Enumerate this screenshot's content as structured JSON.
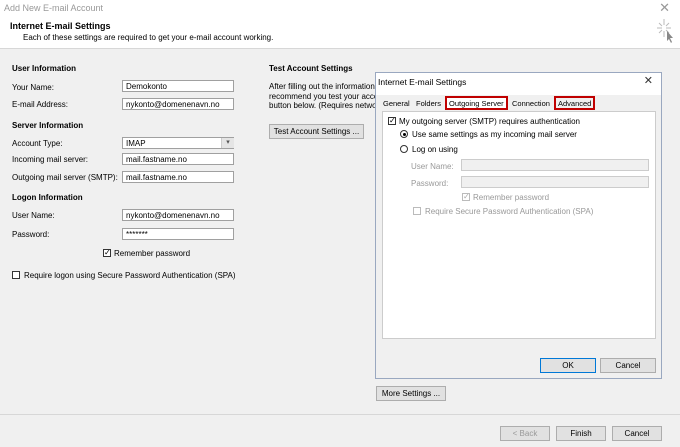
{
  "window": {
    "title": "Add New E-mail Account"
  },
  "header": {
    "title": "Internet E-mail Settings",
    "subtitle": "Each of these settings are required to get your e-mail account working."
  },
  "user_info": {
    "heading": "User Information",
    "your_name_label": "Your Name:",
    "your_name_value": "Demokonto",
    "email_label": "E-mail Address:",
    "email_value": "nykonto@domenenavn.no"
  },
  "server_info": {
    "heading": "Server Information",
    "account_type_label": "Account Type:",
    "account_type_value": "IMAP",
    "incoming_label": "Incoming mail server:",
    "incoming_value": "mail.fastname.no",
    "outgoing_label": "Outgoing mail server (SMTP):",
    "outgoing_value": "mail.fastname.no"
  },
  "logon_info": {
    "heading": "Logon Information",
    "username_label": "User Name:",
    "username_value": "nykonto@domenenavn.no",
    "password_label": "Password:",
    "password_value": "*******",
    "remember_label": "Remember password",
    "spa_label": "Require logon using Secure Password Authentication (SPA)"
  },
  "test": {
    "heading": "Test Account Settings",
    "line1": "After filling out the information",
    "line2": "recommend you test your acco",
    "line3": "button below. (Requires netwo",
    "button": "Test Account Settings ..."
  },
  "more_settings": "More Settings ...",
  "footer": {
    "back": "< Back",
    "finish": "Finish",
    "cancel": "Cancel"
  },
  "dialog": {
    "title": "Internet E-mail Settings",
    "tabs": [
      "General",
      "Folders",
      "Outgoing Server",
      "Connection",
      "Advanced"
    ],
    "requires_auth": "My outgoing server (SMTP) requires authentication",
    "use_same": "Use same settings as my incoming mail server",
    "log_on_using": "Log on using",
    "username_label": "User Name:",
    "password_label": "Password:",
    "remember_label": "Remember password",
    "spa_label": "Require Secure Password Authentication (SPA)",
    "ok": "OK",
    "cancel": "Cancel"
  },
  "colors": {
    "highlight": "#c00000"
  }
}
